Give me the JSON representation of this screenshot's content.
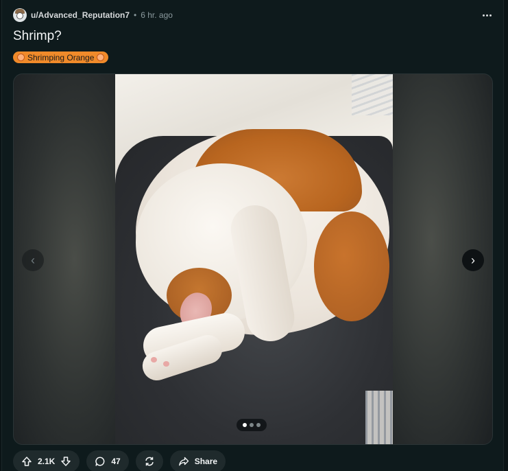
{
  "post": {
    "username": "u/Advanced_Reputation7",
    "separator": "•",
    "time": "6 hr. ago",
    "title": "Shrimp?",
    "flair": "Shrimping Orange",
    "flair_color": "#f08a2a"
  },
  "media": {
    "gallery_count": 3,
    "gallery_active_index": 0,
    "prev_label": "‹",
    "next_label": "›"
  },
  "actions": {
    "score": "2.1K",
    "comments": "47",
    "share_label": "Share"
  },
  "icons": {
    "more": "more-horizontal-icon",
    "upvote": "upvote-arrow-icon",
    "downvote": "downvote-arrow-icon",
    "comment": "comment-bubble-icon",
    "crosspost": "crosspost-icon",
    "share": "share-arrow-icon"
  },
  "colors": {
    "background": "#0b1416",
    "card": "#0e1a1c",
    "pill": "#1f2a2c",
    "text": "#f2f4f5",
    "muted": "#8b9a9e"
  }
}
